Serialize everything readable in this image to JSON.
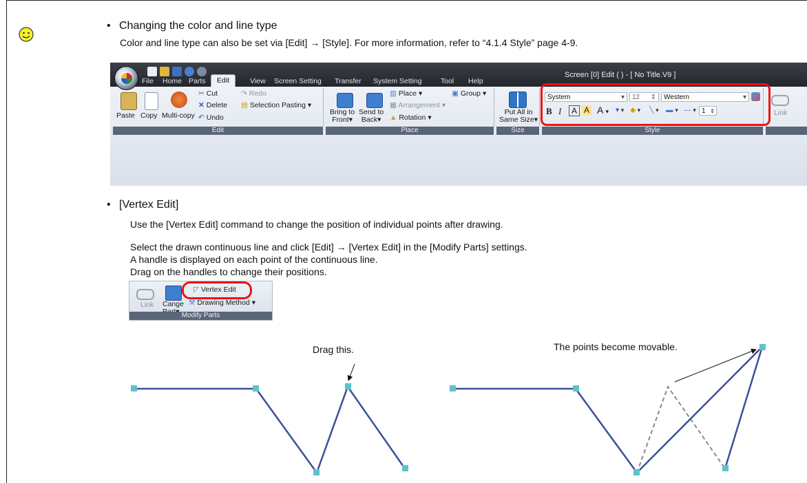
{
  "tip": {
    "icon": "smiley-icon",
    "heading1": "Changing the color and line type",
    "para1": "Color and line type can also be set via [Edit] → [Style]. For more information, refer to “4.1.4 Style” page 4-9.",
    "heading2": "[Vertex Edit]",
    "para2": "Use the [Vertex Edit] command to change the position of individual points after drawing.",
    "para3": [
      "Select the drawn continuous line and click [Edit] → [Vertex Edit] in the [Modify Parts] settings.",
      "A handle is displayed on each point of the continuous line.",
      "Drag on the handles to change their positions."
    ]
  },
  "ribbon": {
    "window_title": "Screen [0] Edit (        ) - [ No Title.V9 ]",
    "tabs": [
      "File",
      "Home",
      "Parts",
      "Edit",
      "View",
      "Screen Setting",
      "Transfer",
      "System Setting",
      "Tool",
      "Help"
    ],
    "active_tab": "Edit",
    "edit_group": {
      "label": "Edit",
      "paste": "Paste",
      "copy": "Copy",
      "multi_copy": "Multi-copy",
      "cut": "Cut",
      "redo": "Redo",
      "delete": "Delete",
      "selection_pasting": "Selection Pasting",
      "undo": "Undo"
    },
    "place_group": {
      "label": "Place",
      "bring_front_1": "Bring to",
      "bring_front_2": "Front",
      "send_back_1": "Send to",
      "send_back_2": "Back",
      "place": "Place",
      "group": "Group",
      "arrangement": "Arrangement",
      "rotation": "Rotation"
    },
    "size_group": {
      "label": "Size",
      "put_all_1": "Put All in",
      "put_all_2": "Same Size"
    },
    "style_group": {
      "label": "Style",
      "font": "System",
      "font_size": "12",
      "charset": "Western",
      "line_width": "1"
    },
    "link_group": {
      "link": "Link"
    }
  },
  "modify_parts": {
    "label": "Modify Parts",
    "link": "Link",
    "change_part_1": "Cange",
    "change_part_2": "Part",
    "vertex_edit": "Vertex Edit",
    "drawing_method": "Drawing Method"
  },
  "annotations": {
    "drag_this": "Drag this.",
    "points_movable": "The points become movable."
  },
  "colors": {
    "line": "#3a4f9a",
    "handle": "#5ec3c9",
    "highlight": "#e11111"
  }
}
